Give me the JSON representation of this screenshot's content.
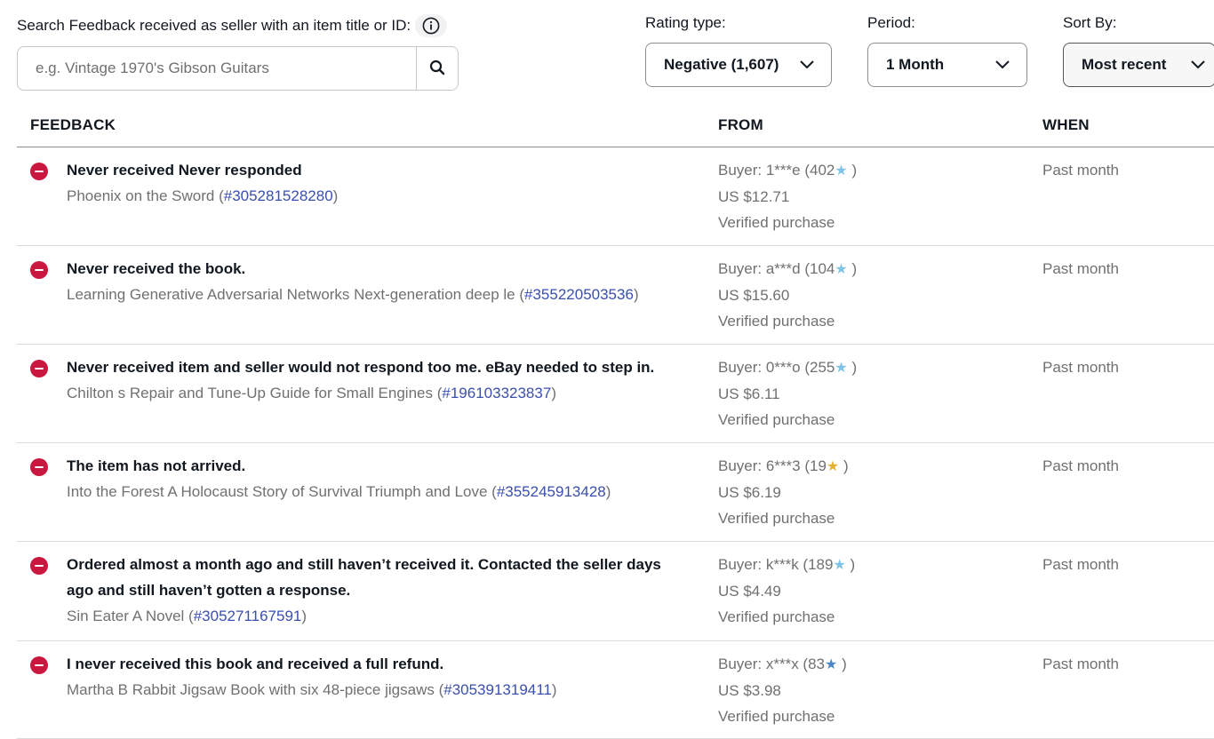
{
  "search": {
    "label": "Search Feedback received as seller with an item title or ID:",
    "placeholder": "e.g. Vintage 1970's Gibson Guitars",
    "value": ""
  },
  "filters": {
    "rating_type": {
      "label": "Rating type:",
      "value": "Negative (1,607)"
    },
    "period": {
      "label": "Period:",
      "value": "1 Month"
    },
    "sort_by": {
      "label": "Sort By:",
      "value": "Most recent"
    }
  },
  "table": {
    "headers": {
      "feedback": "FEEDBACK",
      "from": "FROM",
      "when": "WHEN"
    },
    "rows": [
      {
        "feedback": "Never received Never responded",
        "item_title": "Phoenix on the Sword",
        "item_id": "#305281528280",
        "buyer": "Buyer: 1***e (402",
        "star_color": "#7fc3e6",
        "price": "US $12.71",
        "verified": "Verified purchase",
        "when": "Past month"
      },
      {
        "feedback": "Never received the book.",
        "item_title": "Learning Generative Adversarial Networks Next-generation deep le",
        "item_id": "#355220503536",
        "buyer": "Buyer: a***d (104",
        "star_color": "#7fc3e6",
        "price": "US $15.60",
        "verified": "Verified purchase",
        "when": "Past month"
      },
      {
        "feedback": "Never received item and seller would not respond too me. eBay needed to step in.",
        "item_title": "Chilton s Repair and Tune-Up Guide for Small Engines",
        "item_id": "#196103323837",
        "buyer": "Buyer: 0***o (255",
        "star_color": "#7fc3e6",
        "price": "US $6.11",
        "verified": "Verified purchase",
        "when": "Past month"
      },
      {
        "feedback": "The item has not arrived.",
        "item_title": "Into the Forest A Holocaust Story of Survival Triumph and Love",
        "item_id": "#355245913428",
        "buyer": "Buyer: 6***3 (19",
        "star_color": "#e8b030",
        "price": "US $6.19",
        "verified": "Verified purchase",
        "when": "Past month"
      },
      {
        "feedback": "Ordered almost a month ago and still haven’t received it. Contacted the seller days ago and still haven’t gotten a response.",
        "item_title": "Sin Eater A Novel",
        "item_id": "#305271167591",
        "buyer": "Buyer: k***k (189",
        "star_color": "#7fc3e6",
        "price": "US $4.49",
        "verified": "Verified purchase",
        "when": "Past month"
      },
      {
        "feedback": "I never received this book and received a full refund.",
        "item_title": "Martha B Rabbit Jigsaw Book with six 48-piece jigsaws",
        "item_id": "#305391319411",
        "buyer": "Buyer: x***x (83",
        "star_color": "#4a86c8",
        "price": "US $3.98",
        "verified": "Verified purchase",
        "when": "Past month"
      }
    ]
  }
}
